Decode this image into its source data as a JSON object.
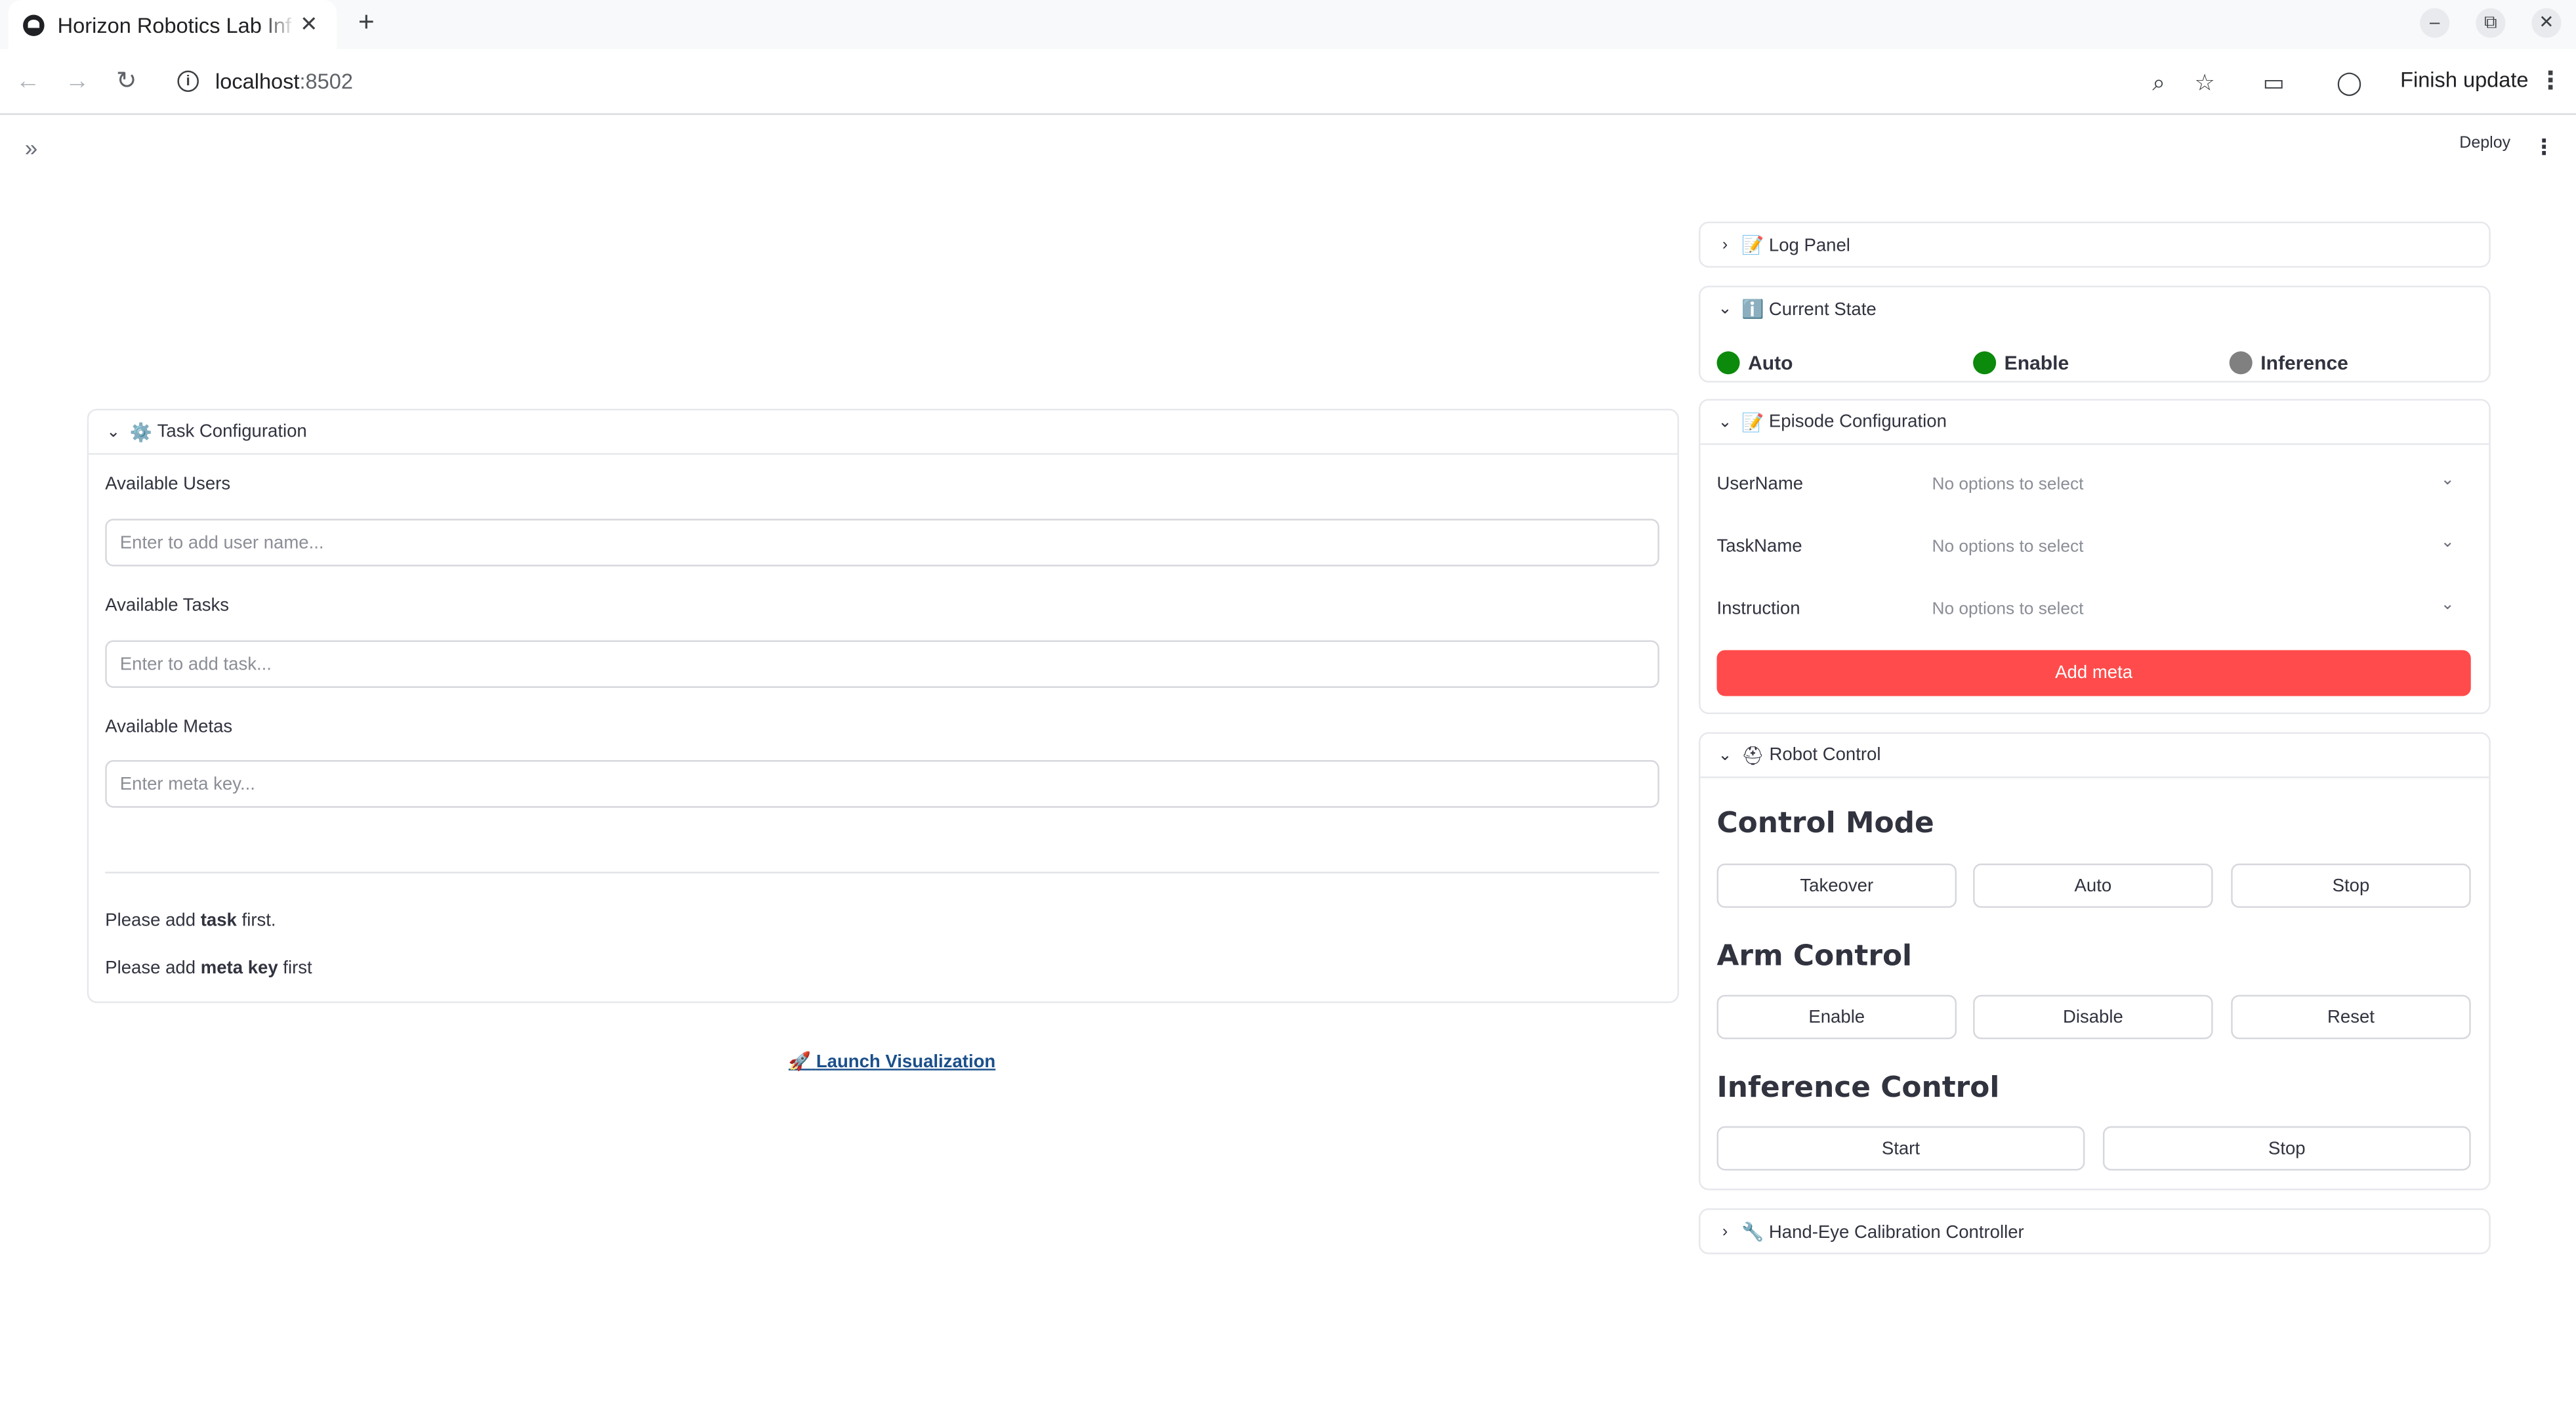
{
  "browser": {
    "tab_title": "Horizon Robotics Lab Inf",
    "tab_close": "✕",
    "new_tab": "+",
    "url_host": "localhost",
    "url_port": ":8502",
    "finish_update": "Finish update",
    "window_controls": {
      "minimize": "–",
      "restore": "⧉",
      "close": "✕"
    },
    "icons": {
      "back": "←",
      "forward": "→",
      "reload": "↻",
      "info": "i",
      "zoom": "⌕",
      "star": "☆",
      "media": "▭",
      "profile": "◯",
      "menu": "⋮"
    }
  },
  "app": {
    "sidebar_toggle": "»",
    "deploy": "Deploy",
    "menu": "⋮"
  },
  "task_config": {
    "chevron": "⌄",
    "emoji": "⚙️",
    "title": "Task Configuration",
    "users_label": "Available Users",
    "users_placeholder": "Enter to add user name...",
    "tasks_label": "Available Tasks",
    "tasks_placeholder": "Enter to add task...",
    "metas_label": "Available Metas",
    "metas_placeholder": "Enter meta key...",
    "note1": {
      "pre": "Please add ",
      "bold": "task",
      "post": " first."
    },
    "note2": {
      "pre": "Please add ",
      "bold": "meta key",
      "post": " first"
    }
  },
  "launch": {
    "emoji": "🚀",
    "label": "Launch Visualization"
  },
  "log_panel": {
    "chevron": "›",
    "emoji": "📝",
    "title": "Log Panel"
  },
  "current_state": {
    "chevron": "⌄",
    "emoji": "ℹ️",
    "title": "Current State",
    "items": [
      {
        "label": "Auto",
        "color": "#0b8a0b"
      },
      {
        "label": "Enable",
        "color": "#0b8a0b"
      },
      {
        "label": "Inference",
        "color": "#808080"
      }
    ]
  },
  "episode_config": {
    "chevron": "⌄",
    "emoji": "📝",
    "title": "Episode Configuration",
    "fields": [
      {
        "label": "UserName",
        "value": "No options to select"
      },
      {
        "label": "TaskName",
        "value": "No options to select"
      },
      {
        "label": "Instruction",
        "value": "No options to select"
      }
    ],
    "select_chevron": "⌄",
    "add_meta": "Add meta"
  },
  "robot_control": {
    "chevron": "⌄",
    "emoji": "⛑",
    "title": "Robot Control",
    "control_mode": {
      "title": "Control Mode",
      "buttons": [
        "Takeover",
        "Auto",
        "Stop"
      ]
    },
    "arm_control": {
      "title": "Arm Control",
      "buttons": [
        "Enable",
        "Disable",
        "Reset"
      ]
    },
    "inference_control": {
      "title": "Inference Control",
      "buttons": [
        "Start",
        "Stop"
      ]
    }
  },
  "hand_eye": {
    "chevron": "›",
    "emoji": "🔧",
    "title": "Hand-Eye Calibration Controller"
  },
  "colors": {
    "accent": "#ff4b4b",
    "active_state": "#0b8a0b",
    "inactive_state": "#808080"
  }
}
